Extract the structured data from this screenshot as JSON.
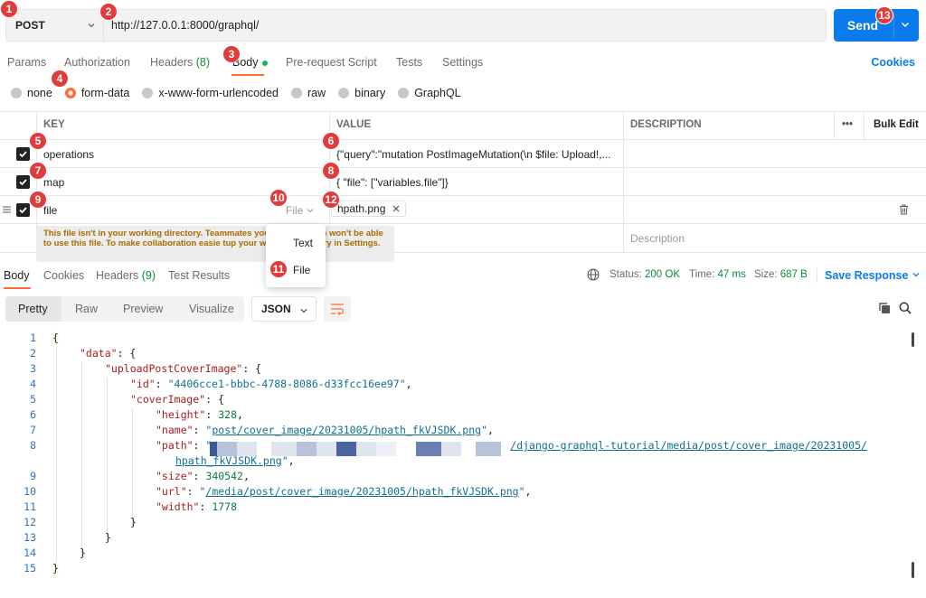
{
  "badges": [
    "1",
    "2",
    "3",
    "4",
    "5",
    "6",
    "7",
    "8",
    "9",
    "10",
    "11",
    "12",
    "13"
  ],
  "request": {
    "method": "POST",
    "url": "http://127.0.0.1:8000/graphql/",
    "send_label": "Send"
  },
  "tabs": [
    {
      "label": "Params"
    },
    {
      "label": "Authorization"
    },
    {
      "label": "Headers",
      "count": "(8)"
    },
    {
      "label": "Body"
    },
    {
      "label": "Pre-request Script"
    },
    {
      "label": "Tests"
    },
    {
      "label": "Settings"
    }
  ],
  "cookies_label": "Cookies",
  "body_types": [
    "none",
    "form-data",
    "x-www-form-urlencoded",
    "raw",
    "binary",
    "GraphQL"
  ],
  "table": {
    "headers": {
      "key": "KEY",
      "value": "VALUE",
      "description": "DESCRIPTION",
      "more": "•••",
      "bulk": "Bulk Edit"
    },
    "rows": [
      {
        "key": "operations",
        "value": "{\"query\":\"mutation PostImageMutation(\\n  $file: Upload!,..."
      },
      {
        "key": "map",
        "value": "{ \"file\": [\"variables.file\"]}"
      },
      {
        "key": "file",
        "type": "File",
        "value": "hpath.png"
      }
    ],
    "description_placeholder": "Description"
  },
  "tooltip": "This file isn't in your working directory. Teammates you sh      quest with won't be able to use this file. To make collaboration easie        tup your working directory in Settings.",
  "type_dropdown": [
    "Text",
    "File"
  ],
  "response": {
    "tabs": [
      {
        "label": "Body"
      },
      {
        "label": "Cookies"
      },
      {
        "label": "Headers",
        "count": "(9)"
      },
      {
        "label": "Test Results"
      }
    ],
    "status_label": "Status:",
    "status_value": "200 OK",
    "time_label": "Time:",
    "time_value": "47 ms",
    "size_label": "Size:",
    "size_value": "687 B",
    "save_label": "Save Response"
  },
  "view_modes": [
    "Pretty",
    "Raw",
    "Preview",
    "Visualize"
  ],
  "format": "JSON",
  "code": {
    "line_numbers": [
      "1",
      "2",
      "3",
      "4",
      "5",
      "6",
      "7",
      "8",
      "",
      "9",
      "10",
      "11",
      "12",
      "13",
      "14",
      "15"
    ],
    "l1": "{",
    "k_data": "\"data\"",
    "k_upload": "\"uploadPostCoverImage\"",
    "k_id": "\"id\"",
    "v_id": "\"4406cce1-bbbc-4788-8086-d33fcc16ee97\"",
    "k_cover": "\"coverImage\"",
    "k_height": "\"height\"",
    "v_height": "328",
    "k_name": "\"name\"",
    "v_name_q": "\"",
    "v_name": "post/cover_image/20231005/hpath_fkVJSDK.png",
    "k_path": "\"path\"",
    "v_path_start": "/",
    "v_path_end": "/django-graphql-tutorial/media/post/cover_image/20231005/",
    "v_path_cont": "hpath_fkVJSDK.png",
    "k_size": "\"size\"",
    "v_size": "340542",
    "k_url": "\"url\"",
    "v_url": "/media/post/cover_image/20231005/hpath_fkVJSDK.png",
    "k_width": "\"width\"",
    "v_width": "1778",
    "close": "}"
  }
}
